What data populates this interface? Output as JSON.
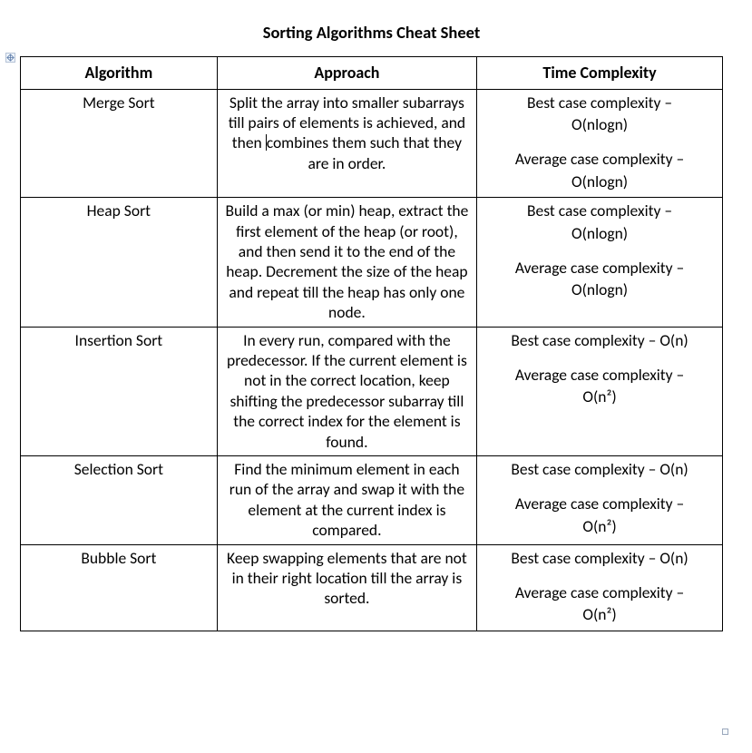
{
  "title": "Sorting Algorithms Cheat Sheet",
  "columns": {
    "algorithm": "Algorithm",
    "approach": "Approach",
    "time": "Time Complexity"
  },
  "rows": [
    {
      "algorithm": "Merge Sort",
      "approach_a": "Split the array into smaller subarrays till pairs of elements is achieved, and then ",
      "approach_b": "combines them such that they are in order.",
      "best_label": "Best case complexity –",
      "best_value": "O(nlogn)",
      "avg_label": "Average case complexity –",
      "avg_value": "O(nlogn)"
    },
    {
      "algorithm": "Heap Sort",
      "approach": "Build a max (or min) heap, extract the first element of the heap (or root), and then send it to the end of the heap. Decrement the size of the heap and repeat till the heap has only one node.",
      "best_label": "Best case complexity –",
      "best_value": "O(nlogn)",
      "avg_label": "Average case complexity –",
      "avg_value": "O(nlogn)"
    },
    {
      "algorithm": "Insertion Sort",
      "approach": "In every run, compared with the predecessor. If the current element is not in the correct location, keep shifting the predecessor subarray till the correct index for the element is found.",
      "best_label": "Best case complexity – O(n)",
      "best_value": "",
      "avg_label": "Average case complexity –",
      "avg_value": "O(n²)"
    },
    {
      "algorithm": "Selection Sort",
      "approach": "Find the minimum element in each run of the array and swap it with the element at the current index is compared.",
      "best_label": "Best case complexity – O(n)",
      "best_value": "",
      "avg_label": "Average case complexity –",
      "avg_value": "O(n²)"
    },
    {
      "algorithm": "Bubble Sort",
      "approach": "Keep swapping elements that are not in their right location till the array is sorted.",
      "best_label": "Best case complexity – O(n)",
      "best_value": "",
      "avg_label": "Average case complexity –",
      "avg_value": "O(n²)"
    }
  ]
}
